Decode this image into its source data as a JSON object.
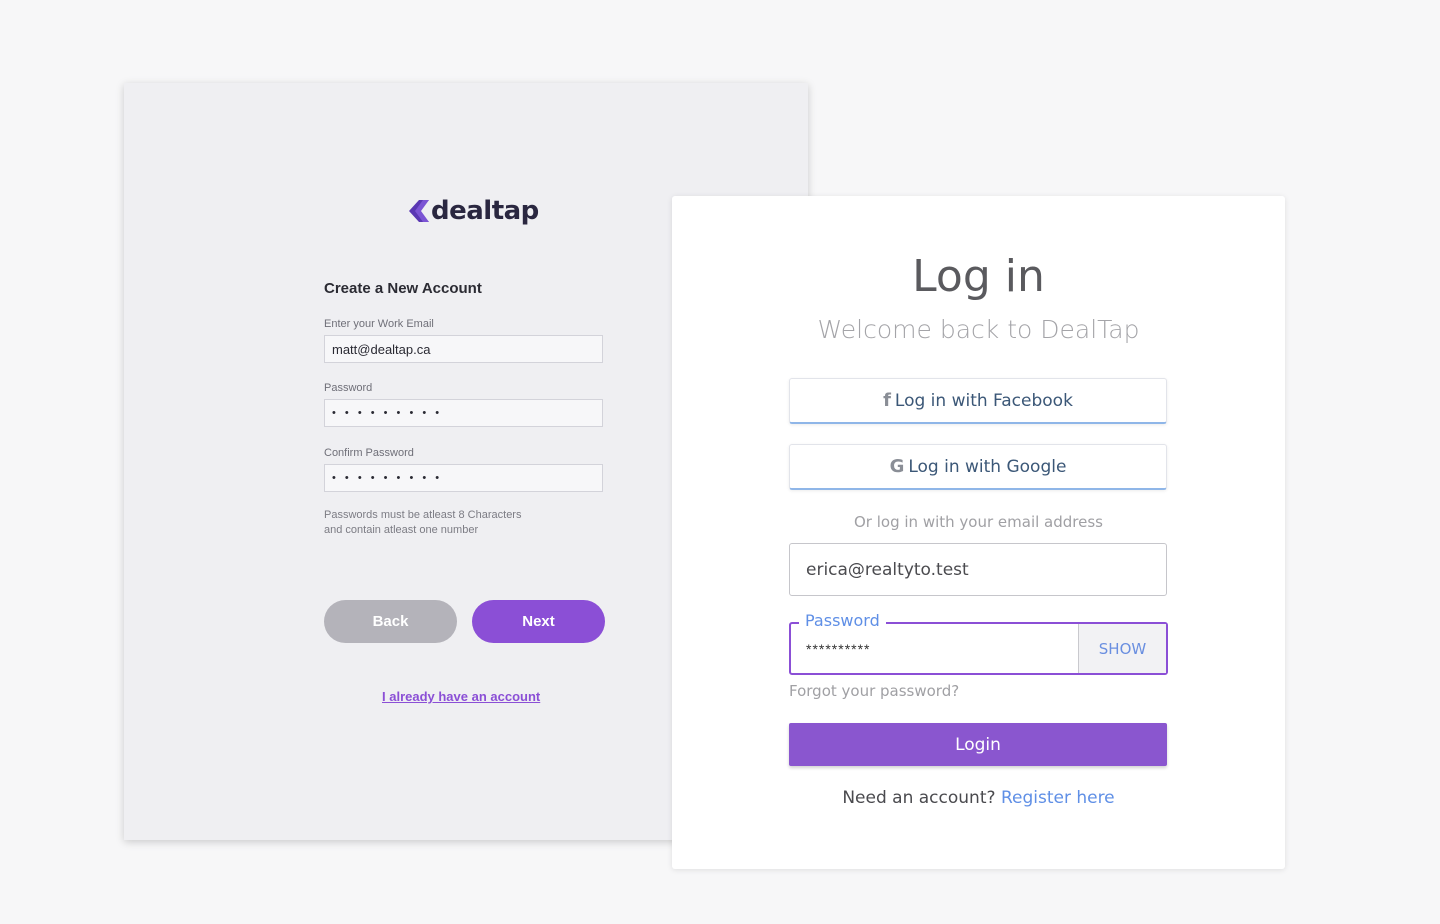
{
  "signup": {
    "logo_text": "dealtap",
    "title": "Create a New Account",
    "email_label": "Enter your Work Email",
    "email_value": "matt@dealtap.ca",
    "password_label": "Password",
    "password_value": "• • • • • • • • •",
    "confirm_label": "Confirm Password",
    "confirm_value": "• • • • • • • • •",
    "hint_line1": "Passwords must be atleast 8 Characters",
    "hint_line2": "and contain atleast one number",
    "back_label": "Back",
    "next_label": "Next",
    "already_link": "I already have an account",
    "brand_color": "#8b4fd6"
  },
  "login": {
    "title": "Log in",
    "subtitle": "Welcome back to DealTap",
    "facebook_icon": "facebook-icon",
    "facebook_label": "Log in with Facebook",
    "google_icon": "google-icon",
    "google_label": "Log in with Google",
    "or_text": "Or log in with your email address",
    "email_value": "erica@realtyto.test",
    "password_label": "Password",
    "password_value": "**********",
    "show_label": "SHOW",
    "forgot_text": "Forgot your password?",
    "login_label": "Login",
    "need_account": "Need an account?",
    "register_link": "Register here",
    "accent_color": "#8a56cf",
    "link_color": "#5f8fe6"
  }
}
